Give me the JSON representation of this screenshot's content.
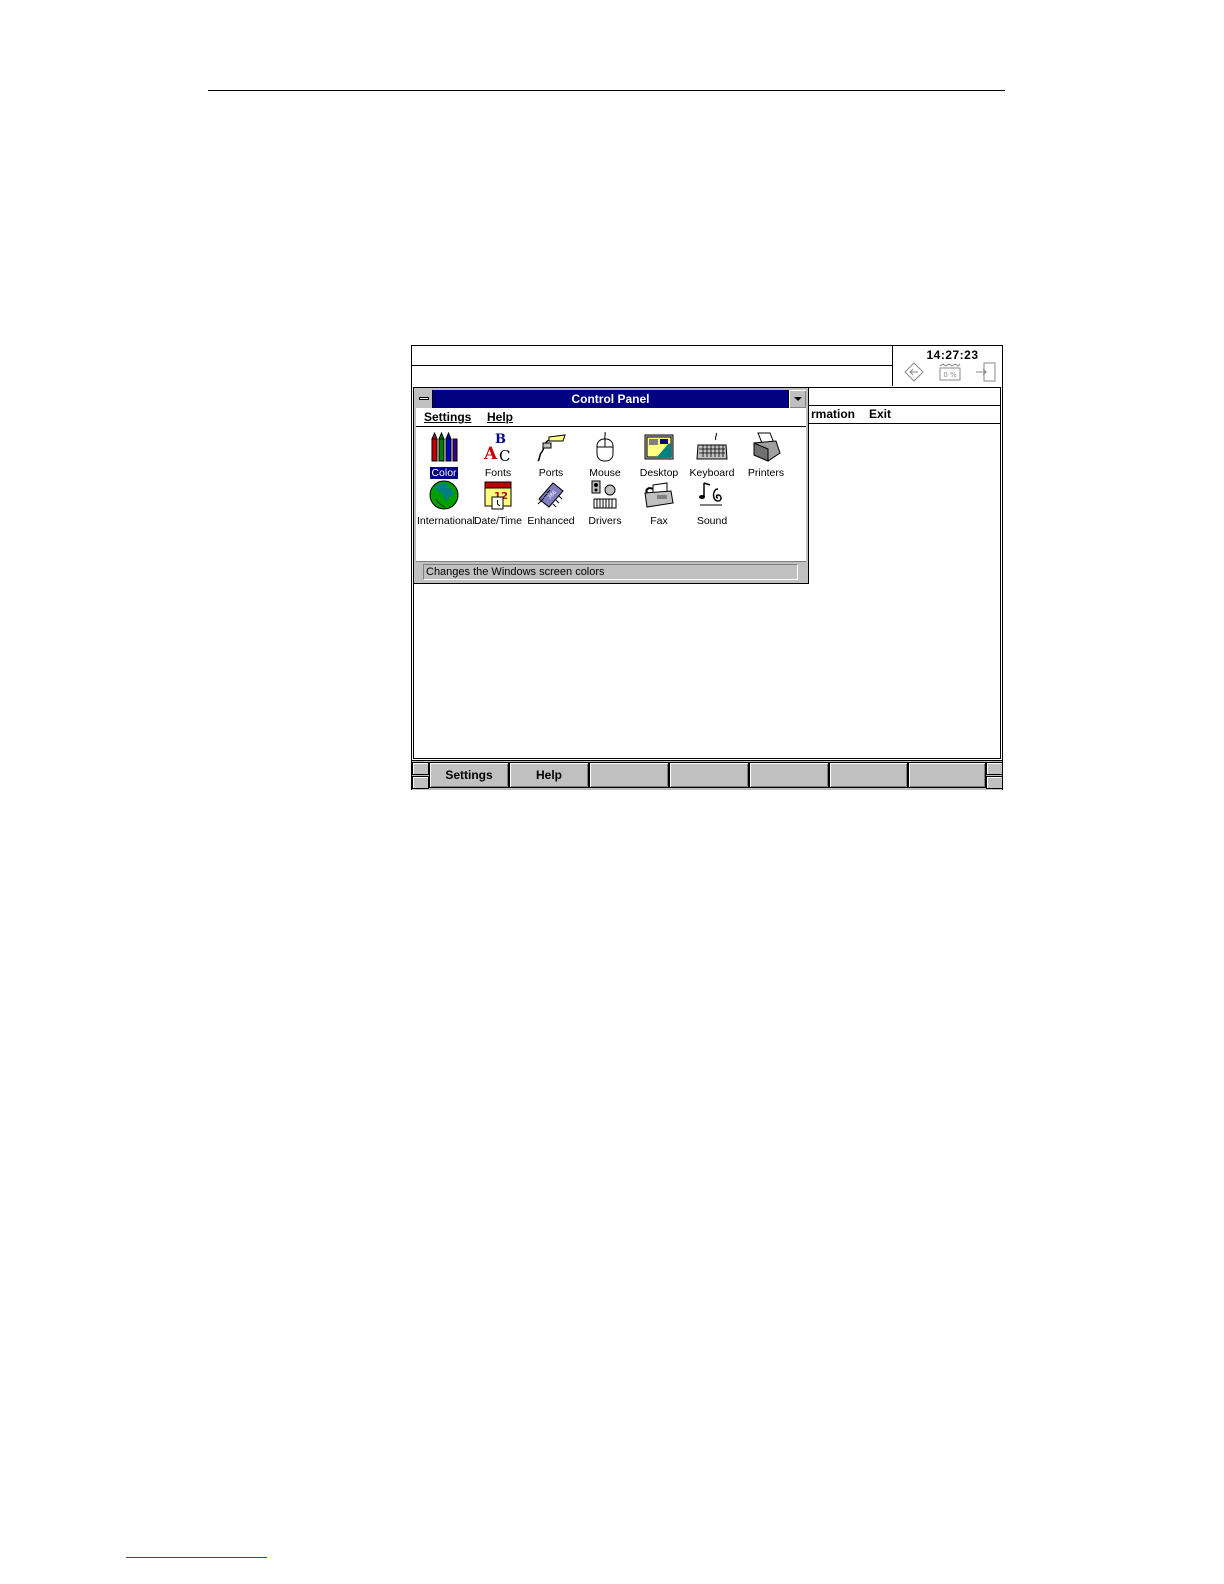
{
  "clock": {
    "time": "14:27:23",
    "icons": [
      "arrow-diamond-icon",
      "memory-gauge-icon",
      "exit-door-icon"
    ],
    "gauge_text": "0 %"
  },
  "main_window": {
    "menu_partial": "rmation",
    "menu_exit": "Exit"
  },
  "control_panel": {
    "title": "Control Panel",
    "menu": [
      "Settings",
      "Help"
    ],
    "items": [
      {
        "label": "Color",
        "icon": "color-icon",
        "selected": true
      },
      {
        "label": "Fonts",
        "icon": "fonts-icon"
      },
      {
        "label": "Ports",
        "icon": "ports-icon"
      },
      {
        "label": "Mouse",
        "icon": "mouse-icon"
      },
      {
        "label": "Desktop",
        "icon": "desktop-icon"
      },
      {
        "label": "Keyboard",
        "icon": "keyboard-icon"
      },
      {
        "label": "Printers",
        "icon": "printers-icon"
      },
      {
        "label": "International",
        "icon": "globe-icon"
      },
      {
        "label": "Date/Time",
        "icon": "calendar-icon"
      },
      {
        "label": "Enhanced",
        "icon": "chip-icon"
      },
      {
        "label": "Drivers",
        "icon": "drivers-icon"
      },
      {
        "label": "Fax",
        "icon": "fax-icon"
      },
      {
        "label": "Sound",
        "icon": "sound-icon"
      }
    ],
    "status": "Changes the Windows screen colors"
  },
  "bottom_bar": {
    "buttons": [
      "Settings",
      "Help",
      "",
      "",
      "",
      "",
      ""
    ]
  },
  "colors": {
    "title_bar": "#000080",
    "chrome": "#c0c0c0"
  }
}
